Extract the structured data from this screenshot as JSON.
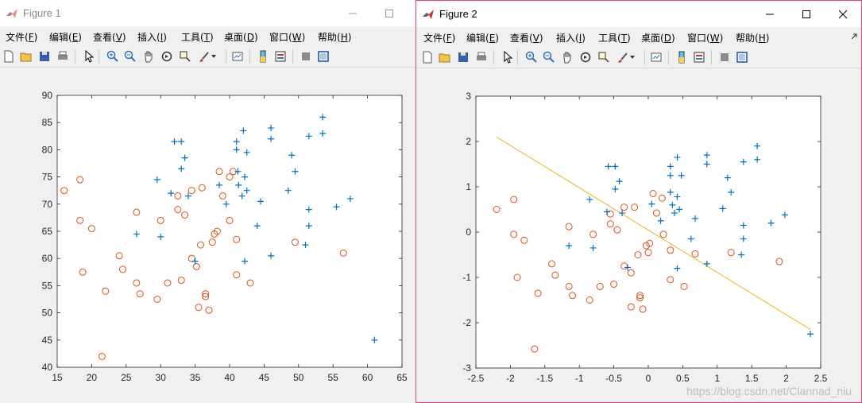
{
  "colors": {
    "accent_border": "#d4447c",
    "series_circle": "#d95319",
    "series_plus": "#0072bd",
    "line": "#edb120"
  },
  "menu_labels": [
    {
      "text": "文件",
      "key": "F"
    },
    {
      "text": "编辑",
      "key": "E"
    },
    {
      "text": "查看",
      "key": "V"
    },
    {
      "text": "插入",
      "key": "I"
    },
    {
      "text": "工具",
      "key": "T"
    },
    {
      "text": "桌面",
      "key": "D"
    },
    {
      "text": "窗口",
      "key": "W"
    },
    {
      "text": "帮助",
      "key": "H"
    }
  ],
  "toolbar_icons": [
    "new-file-icon",
    "open-folder-icon",
    "save-icon",
    "print-icon",
    "pointer-icon",
    "zoom-in-icon",
    "zoom-out-icon",
    "pan-hand-icon",
    "rotate-3d-icon",
    "data-cursor-icon",
    "brush-icon",
    "link-plot-icon",
    "colorbar-icon",
    "legend-icon",
    "hide-plot-tools-icon",
    "show-plot-tools-icon"
  ],
  "window1": {
    "title": "Figure 1"
  },
  "window2": {
    "title": "Figure 2"
  },
  "watermark": "https://blog.csdn.net/Clannad_niu",
  "chart_data": [
    {
      "type": "scatter",
      "xlim": [
        15,
        65
      ],
      "ylim": [
        40,
        90
      ],
      "xticks": [
        15,
        20,
        25,
        30,
        35,
        40,
        45,
        50,
        55,
        60,
        65
      ],
      "yticks": [
        40,
        45,
        50,
        55,
        60,
        65,
        70,
        75,
        80,
        85,
        90
      ],
      "grid": false,
      "series": [
        {
          "marker": "o",
          "color": "#d95319",
          "points": [
            [
              16,
              72.5
            ],
            [
              18.3,
              74.5
            ],
            [
              18.3,
              67
            ],
            [
              18.7,
              57.5
            ],
            [
              20,
              65.5
            ],
            [
              21.5,
              42
            ],
            [
              22,
              54
            ],
            [
              24,
              60.5
            ],
            [
              24.5,
              58
            ],
            [
              26.5,
              55.5
            ],
            [
              26.5,
              68.5
            ],
            [
              27,
              53.5
            ],
            [
              29.5,
              52.5
            ],
            [
              30,
              67
            ],
            [
              31,
              55.5
            ],
            [
              32.5,
              69
            ],
            [
              32.5,
              71.5
            ],
            [
              33,
              56
            ],
            [
              33.5,
              68
            ],
            [
              34.5,
              60
            ],
            [
              34.5,
              72.5
            ],
            [
              35.2,
              58.5
            ],
            [
              35.5,
              51
            ],
            [
              35.8,
              62.5
            ],
            [
              36,
              73
            ],
            [
              36.5,
              53.5
            ],
            [
              36.5,
              53
            ],
            [
              37,
              50.5
            ],
            [
              37.5,
              63
            ],
            [
              37.8,
              64.5
            ],
            [
              38.2,
              65
            ],
            [
              38.5,
              76
            ],
            [
              39,
              71.5
            ],
            [
              40,
              75
            ],
            [
              40,
              67
            ],
            [
              40.5,
              76
            ],
            [
              41,
              63.5
            ],
            [
              41,
              57
            ],
            [
              43,
              55.5
            ],
            [
              49.5,
              63
            ],
            [
              56.5,
              61
            ]
          ]
        },
        {
          "marker": "+",
          "color": "#0072bd",
          "points": [
            [
              26.5,
              64.5
            ],
            [
              29.5,
              74.5
            ],
            [
              30,
              64
            ],
            [
              31.5,
              72
            ],
            [
              32,
              81.5
            ],
            [
              33,
              81.5
            ],
            [
              33,
              76.5
            ],
            [
              33.5,
              78.5
            ],
            [
              34,
              71.5
            ],
            [
              35,
              59.5
            ],
            [
              38.5,
              73.5
            ],
            [
              39.5,
              70
            ],
            [
              41,
              81.5
            ],
            [
              41,
              80
            ],
            [
              41.2,
              76
            ],
            [
              41.3,
              73.5
            ],
            [
              41.8,
              71.5
            ],
            [
              42,
              83.5
            ],
            [
              42.2,
              75
            ],
            [
              42.2,
              59.5
            ],
            [
              42.5,
              72.5
            ],
            [
              42.5,
              79.5
            ],
            [
              44,
              66
            ],
            [
              44.5,
              70.5
            ],
            [
              46,
              84
            ],
            [
              46,
              82
            ],
            [
              46,
              60.5
            ],
            [
              48.5,
              72.5
            ],
            [
              49,
              79
            ],
            [
              49.5,
              76
            ],
            [
              51,
              62.5
            ],
            [
              51.5,
              69
            ],
            [
              51.5,
              66
            ],
            [
              51.5,
              82.5
            ],
            [
              53.5,
              86
            ],
            [
              53.5,
              83
            ],
            [
              55.5,
              69.5
            ],
            [
              57.5,
              71
            ],
            [
              61,
              45
            ]
          ]
        }
      ]
    },
    {
      "type": "scatter",
      "xlim": [
        -2.5,
        2.5
      ],
      "ylim": [
        -3,
        3
      ],
      "xticks": [
        -2.5,
        -2,
        -1.5,
        -1,
        -0.5,
        0,
        0.5,
        1,
        1.5,
        2,
        2.5
      ],
      "yticks": [
        -3,
        -2,
        -1,
        0,
        1,
        2,
        3
      ],
      "grid": false,
      "series": [
        {
          "marker": "o",
          "color": "#d95319",
          "points": [
            [
              -2.2,
              0.5
            ],
            [
              -1.95,
              0.72
            ],
            [
              -1.95,
              -0.05
            ],
            [
              -1.9,
              -1
            ],
            [
              -1.8,
              -0.18
            ],
            [
              -1.65,
              -2.58
            ],
            [
              -1.6,
              -1.35
            ],
            [
              -1.4,
              -0.7
            ],
            [
              -1.35,
              -0.95
            ],
            [
              -1.15,
              0.12
            ],
            [
              -1.15,
              -1.2
            ],
            [
              -1.1,
              -1.4
            ],
            [
              -0.85,
              -1.5
            ],
            [
              -0.8,
              -0.05
            ],
            [
              -0.7,
              -1.2
            ],
            [
              -0.55,
              0.4
            ],
            [
              -0.55,
              0.18
            ],
            [
              -0.5,
              -1.15
            ],
            [
              -0.45,
              0.05
            ],
            [
              -0.35,
              0.55
            ],
            [
              -0.35,
              -0.75
            ],
            [
              -0.25,
              -0.9
            ],
            [
              -0.25,
              -1.65
            ],
            [
              -0.2,
              0.55
            ],
            [
              -0.15,
              -0.5
            ],
            [
              -0.12,
              -1.4
            ],
            [
              -0.12,
              -1.45
            ],
            [
              -0.08,
              -1.7
            ],
            [
              -0.03,
              -0.3
            ],
            [
              0,
              -0.45
            ],
            [
              0.02,
              -0.25
            ],
            [
              0.07,
              0.85
            ],
            [
              0.12,
              0.42
            ],
            [
              0.2,
              0.75
            ],
            [
              0.22,
              -0.05
            ],
            [
              0.32,
              -0.4
            ],
            [
              0.32,
              -1.05
            ],
            [
              0.52,
              -1.2
            ],
            [
              0.68,
              -0.48
            ],
            [
              1.2,
              -0.45
            ],
            [
              1.9,
              -0.65
            ]
          ]
        },
        {
          "marker": "+",
          "color": "#0072bd",
          "points": [
            [
              -1.15,
              -0.3
            ],
            [
              -0.85,
              0.72
            ],
            [
              -0.8,
              -0.35
            ],
            [
              -0.6,
              0.45
            ],
            [
              -0.58,
              1.45
            ],
            [
              -0.48,
              1.45
            ],
            [
              -0.48,
              0.95
            ],
            [
              -0.42,
              1.12
            ],
            [
              -0.38,
              0.42
            ],
            [
              -0.3,
              -0.78
            ],
            [
              0.05,
              0.62
            ],
            [
              0.18,
              0.25
            ],
            [
              0.32,
              1.45
            ],
            [
              0.32,
              1.25
            ],
            [
              0.32,
              0.88
            ],
            [
              0.35,
              0.6
            ],
            [
              0.38,
              0.42
            ],
            [
              0.42,
              1.65
            ],
            [
              0.42,
              0.78
            ],
            [
              0.42,
              -0.8
            ],
            [
              0.45,
              0.5
            ],
            [
              0.48,
              1.25
            ],
            [
              0.62,
              -0.15
            ],
            [
              0.68,
              0.3
            ],
            [
              0.85,
              1.7
            ],
            [
              0.85,
              1.5
            ],
            [
              0.85,
              -0.7
            ],
            [
              1.08,
              0.52
            ],
            [
              1.15,
              1.2
            ],
            [
              1.2,
              0.88
            ],
            [
              1.35,
              -0.5
            ],
            [
              1.38,
              1.55
            ],
            [
              1.38,
              0.15
            ],
            [
              1.38,
              -0.15
            ],
            [
              1.58,
              1.9
            ],
            [
              1.58,
              1.6
            ],
            [
              1.78,
              0.2
            ],
            [
              1.98,
              0.38
            ],
            [
              2.35,
              -2.25
            ]
          ]
        }
      ],
      "line": {
        "color": "#edb120",
        "x": [
          -2.2,
          2.35
        ],
        "y": [
          2.1,
          -2.15
        ]
      }
    }
  ]
}
